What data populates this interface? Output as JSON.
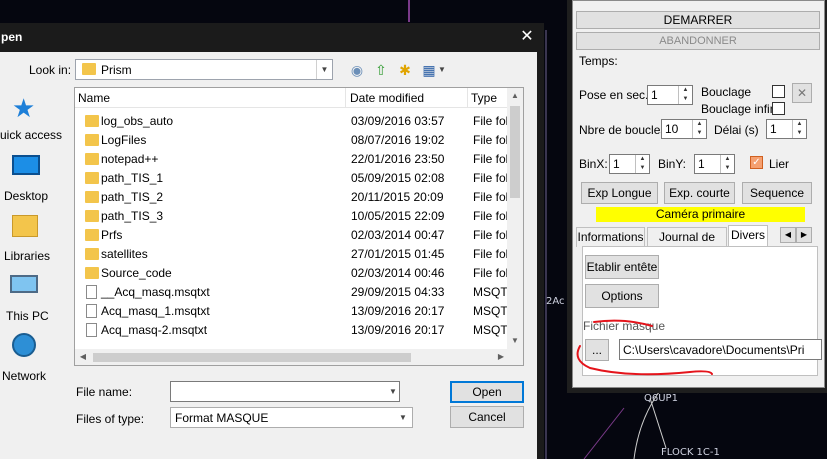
{
  "background": {
    "fragments": [
      "2Ac",
      "Q6UP1",
      "FLOCK 1C-1"
    ]
  },
  "dialog": {
    "title": "pen",
    "close_glyph": "✕",
    "look_in_label": "Look in:",
    "look_in_value": "Prism",
    "places": [
      {
        "label": "uick access"
      },
      {
        "label": "Desktop"
      },
      {
        "label": "Libraries"
      },
      {
        "label": "This PC"
      },
      {
        "label": "Network"
      }
    ],
    "columns": {
      "name": "Name",
      "date": "Date modified",
      "type": "Type"
    },
    "files": [
      {
        "name": "log_obs_auto",
        "date": "03/09/2016 03:57",
        "type": "File fol",
        "kind": "folder"
      },
      {
        "name": "LogFiles",
        "date": "08/07/2016 19:02",
        "type": "File fol",
        "kind": "folder"
      },
      {
        "name": "notepad++",
        "date": "22/01/2016 23:50",
        "type": "File fol",
        "kind": "folder"
      },
      {
        "name": "path_TIS_1",
        "date": "05/09/2015 02:08",
        "type": "File fol",
        "kind": "folder"
      },
      {
        "name": "path_TIS_2",
        "date": "20/11/2015 20:09",
        "type": "File fol",
        "kind": "folder"
      },
      {
        "name": "path_TIS_3",
        "date": "10/05/2015 22:09",
        "type": "File fol",
        "kind": "folder"
      },
      {
        "name": "Prfs",
        "date": "02/03/2014 00:47",
        "type": "File fol",
        "kind": "folder"
      },
      {
        "name": "satellites",
        "date": "27/01/2015 01:45",
        "type": "File fol",
        "kind": "folder"
      },
      {
        "name": "Source_code",
        "date": "02/03/2014 00:46",
        "type": "File fol",
        "kind": "folder"
      },
      {
        "name": "__Acq_masq.msqtxt",
        "date": "29/09/2015 04:33",
        "type": "MSQTX",
        "kind": "file"
      },
      {
        "name": "Acq_masq_1.msqtxt",
        "date": "13/09/2016 20:17",
        "type": "MSQTX",
        "kind": "file"
      },
      {
        "name": "Acq_masq-2.msqtxt",
        "date": "13/09/2016 20:17",
        "type": "MSQTX",
        "kind": "file"
      }
    ],
    "file_name_label": "File name:",
    "file_name_value": "",
    "file_type_label": "Files of type:",
    "file_type_value": "Format MASQUE",
    "open_label": "Open",
    "cancel_label": "Cancel"
  },
  "panel": {
    "start_label": "DEMARRER",
    "abort_label": "ABANDONNER",
    "time_label": "Temps:",
    "exposure_label": "Pose en sec.",
    "exposure_value": "1",
    "loop_label": "Bouclage",
    "loop_infinite_label": "Bouclage infini",
    "loop_count_label": "Nbre de boucles",
    "loop_count_value": "10",
    "delay_label": "Délai (s)",
    "delay_value": "1",
    "binx_label": "BinX:",
    "binx_value": "1",
    "biny_label": "BinY:",
    "biny_value": "1",
    "link_label": "Lier",
    "long_exp_label": "Exp Longue",
    "short_exp_label": "Exp. courte",
    "sequence_label": "Sequence",
    "camera_banner": "Caméra primaire",
    "tabs": [
      "Informations",
      "Journal de nuit",
      "Divers"
    ],
    "header_button": "Etablir entête",
    "options_button": "Options",
    "mask_file_label": "Fichier masque",
    "browse_label": "...",
    "mask_path": "C:\\Users\\cavadore\\Documents\\Pri",
    "clear_glyph": "✕"
  },
  "colors": {
    "banner": "#ffff00",
    "annotation": "#e4141b",
    "folder": "#f3c54b",
    "focus": "#0078d7"
  }
}
